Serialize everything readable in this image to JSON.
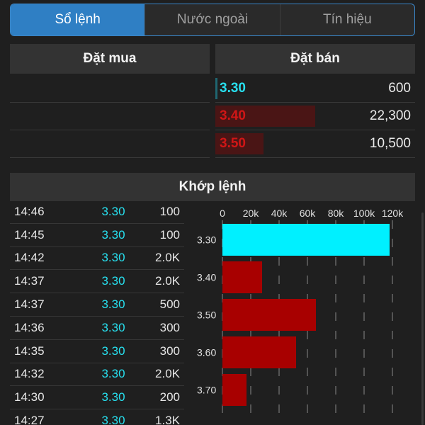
{
  "tabs": [
    {
      "label": "Sổ lệnh",
      "active": true
    },
    {
      "label": "Nước ngoài",
      "active": false
    },
    {
      "label": "Tín hiệu",
      "active": false
    }
  ],
  "order_book": {
    "buy_header": "Đặt mua",
    "sell_header": "Đặt bán",
    "sell_rows": [
      {
        "price": "3.30",
        "volume": "600",
        "color": "#27e0ef",
        "depth": 0.01
      },
      {
        "price": "3.40",
        "volume": "22,300",
        "color": "#d01616",
        "depth": 0.5
      },
      {
        "price": "3.50",
        "volume": "10,500",
        "color": "#d01616",
        "depth": 0.24
      }
    ]
  },
  "match": {
    "header": "Khớp lệnh",
    "trades": [
      {
        "time": "14:46",
        "price": "3.30",
        "volume": "100"
      },
      {
        "time": "14:45",
        "price": "3.30",
        "volume": "100"
      },
      {
        "time": "14:42",
        "price": "3.30",
        "volume": "2.0K"
      },
      {
        "time": "14:37",
        "price": "3.30",
        "volume": "2.0K"
      },
      {
        "time": "14:37",
        "price": "3.30",
        "volume": "500"
      },
      {
        "time": "14:36",
        "price": "3.30",
        "volume": "300"
      },
      {
        "time": "14:35",
        "price": "3.30",
        "volume": "300"
      },
      {
        "time": "14:32",
        "price": "3.30",
        "volume": "2.0K"
      },
      {
        "time": "14:30",
        "price": "3.30",
        "volume": "200"
      },
      {
        "time": "14:27",
        "price": "3.30",
        "volume": "1.3K"
      }
    ]
  },
  "colors": {
    "up": "#27e0ef",
    "down_bar": "#a80000",
    "up_bar": "#00f0ff",
    "accent": "#2f7fc4"
  },
  "chart_data": {
    "type": "bar",
    "orientation": "horizontal",
    "categories": [
      "3.30",
      "3.40",
      "3.50",
      "3.60",
      "3.70"
    ],
    "values": [
      118000,
      28000,
      66000,
      52000,
      17000
    ],
    "bar_colors": [
      "#00f0ff",
      "#a80000",
      "#a80000",
      "#a80000",
      "#a80000"
    ],
    "xticks": [
      0,
      20000,
      40000,
      60000,
      80000,
      100000,
      120000
    ],
    "xtick_labels": [
      "0",
      "20k",
      "40k",
      "60k",
      "80k",
      "100k",
      "120k"
    ],
    "xlim": [
      0,
      120000
    ],
    "grid": true
  }
}
